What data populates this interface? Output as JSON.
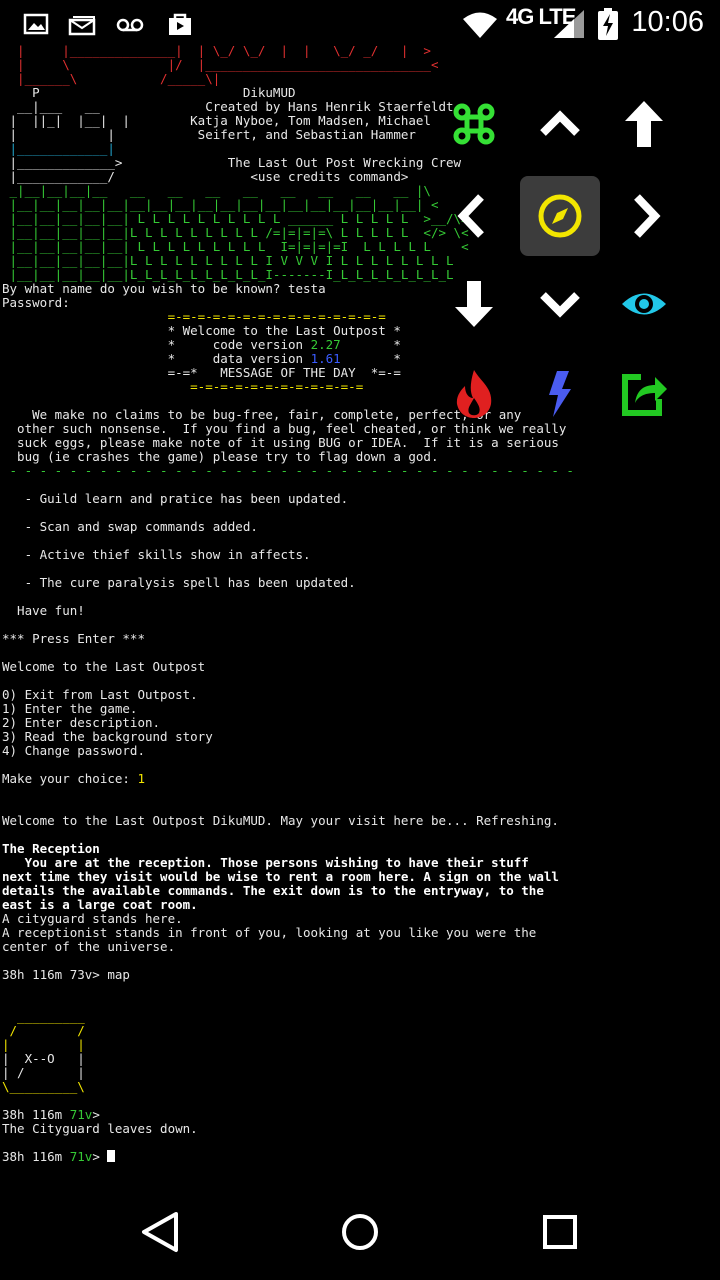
{
  "status_bar": {
    "time": "10:06",
    "network": "4G LTE",
    "icons": [
      "image-icon",
      "mail-stack-icon",
      "voicemail-icon",
      "store-bag-icon",
      "wifi-icon",
      "signal-icon",
      "battery-charging-icon"
    ]
  },
  "terminal": {
    "lines": [
      {
        "t": "  |     |______________|  | \\_/ \\_/  |  |   \\_/ _/   |  >",
        "c": "r"
      },
      {
        "t": "  |     \\             |/  |______________________________<",
        "c": "r"
      },
      {
        "t": "  |______\\           /_____\\|",
        "c": "r"
      },
      {
        "t": "    P                           DikuMUD",
        "c": ""
      },
      {
        "t": "  __|___   __              Created by Hans Henrik Staerfeldt,",
        "c": ""
      },
      {
        "t": " |  ||_|  |__|  |        Katja Nyboe, Tom Madsen, Michael",
        "c": ""
      },
      {
        "t": " |            |           Seifert, and Sebastian Hammer",
        "c": ""
      },
      {
        "t": " |____________|",
        "c": "c"
      },
      {
        "t": " |_____________>              The Last Out Post Wrecking Crew",
        "c": ""
      },
      {
        "t": " |____________/                  <use credits command>",
        "c": ""
      },
      {
        "t": " _|__|__|__|__   __   __   __   __   __   __   __   __ |\\",
        "c": "g"
      },
      {
        "t": " |__|__|__|__|__|__|__|__|__|__|__|__|__|__|__|__|__|__| <",
        "c": "g"
      },
      {
        "t": " |__|__|__|__|__| L L L L L L L L L L ______ L L L L L  >__/\\>",
        "c": "g"
      },
      {
        "t": " |__|__|__|__|__|L L L L L L L L L /=|=|=|=\\ L L L L L  </> \\<",
        "c": "g"
      },
      {
        "t": " |__|__|__|__|__| L L L L L L L L L  I=|=|=|=I  L L L L L    <",
        "c": "g"
      },
      {
        "t": " |__|__|__|__|__|L L L L L L L L L I V V V I L L L L L L L L",
        "c": "g"
      },
      {
        "t": " |__|__|__|__|__|L_L_L_L_L_L_L_L_L_I-------I_L_L_L_L_L_L_L_L",
        "c": "g"
      },
      {
        "t": "By what name do you wish to be known? testa",
        "c": ""
      },
      {
        "t": "Password:",
        "c": ""
      },
      {
        "t": "                      =-=-=-=-=-=-=-=-=-=-=-=-=-=-=",
        "c": "y"
      },
      {
        "t": "                      * Welcome to the Last Outpost *",
        "c": ""
      },
      {
        "t": "                      *     code version 2.27       *",
        "c": ""
      },
      {
        "t": "                      *     data version 1.61       *",
        "c": ""
      },
      {
        "t": "                      =-=*   MESSAGE OF THE DAY  *=-=",
        "c": ""
      },
      {
        "t": "                         =-=-=-=-=-=-=-=-=-=-=-=",
        "c": "y"
      },
      {
        "t": "",
        "c": ""
      },
      {
        "t": "    We make no claims to be bug-free, fair, complete, perfect, or any",
        "c": ""
      },
      {
        "t": "  other such nonsense.  If you find a bug, feel cheated, or think we really",
        "c": ""
      },
      {
        "t": "  suck eggs, please make note of it using BUG or IDEA.  If it is a serious",
        "c": ""
      },
      {
        "t": "  bug (ie crashes the game) please try to flag down a god.",
        "c": ""
      },
      {
        "t": " - - - - - - - - - - - - - - - - - - - - - - - - - - - - - - - - - - - - - -",
        "c": "g"
      },
      {
        "t": "",
        "c": ""
      },
      {
        "t": "   - Guild learn and pratice has been updated.",
        "c": ""
      },
      {
        "t": "",
        "c": ""
      },
      {
        "t": "   - Scan and swap commands added.",
        "c": ""
      },
      {
        "t": "",
        "c": ""
      },
      {
        "t": "   - Active thief skills show in affects.",
        "c": ""
      },
      {
        "t": "",
        "c": ""
      },
      {
        "t": "   - The cure paralysis spell has been updated.",
        "c": ""
      },
      {
        "t": "",
        "c": ""
      },
      {
        "t": "  Have fun!",
        "c": ""
      },
      {
        "t": "",
        "c": ""
      },
      {
        "t": "*** Press Enter ***",
        "c": ""
      },
      {
        "t": "",
        "c": ""
      },
      {
        "t": "Welcome to the Last Outpost",
        "c": ""
      },
      {
        "t": "",
        "c": ""
      },
      {
        "t": "0) Exit from Last Outpost.",
        "c": ""
      },
      {
        "t": "1) Enter the game.",
        "c": ""
      },
      {
        "t": "2) Enter description.",
        "c": ""
      },
      {
        "t": "3) Read the background story",
        "c": ""
      },
      {
        "t": "4) Change password.",
        "c": ""
      },
      {
        "t": "",
        "c": ""
      },
      {
        "t": "Make your choice: 1",
        "c": ""
      },
      {
        "t": "",
        "c": ""
      },
      {
        "t": "",
        "c": ""
      },
      {
        "t": "Welcome to the Last Outpost DikuMUD. May your visit here be... Refreshing.",
        "c": ""
      },
      {
        "t": "",
        "c": ""
      },
      {
        "t": "The Reception",
        "c": "w"
      },
      {
        "t": "   You are at the reception. Those persons wishing to have their stuff",
        "c": "w"
      },
      {
        "t": "next time they visit would be wise to rent a room here. A sign on the wall",
        "c": "w"
      },
      {
        "t": "details the available commands. The exit down is to the entryway, to the",
        "c": "w"
      },
      {
        "t": "east is a large coat room.",
        "c": "w"
      },
      {
        "t": "A cityguard stands here.",
        "c": ""
      },
      {
        "t": "A receptionist stands in front of you, looking at you like you were the",
        "c": ""
      },
      {
        "t": "center of the universe.",
        "c": ""
      },
      {
        "t": "",
        "c": ""
      },
      {
        "t": "38h 116m 73v> map",
        "c": ""
      },
      {
        "t": "",
        "c": ""
      },
      {
        "t": "",
        "c": ""
      },
      {
        "t": "  _________",
        "c": "y"
      },
      {
        "t": " /        /",
        "c": "y"
      },
      {
        "t": "|         |",
        "c": "y"
      },
      {
        "t": "|  X--O   |",
        "c": ""
      },
      {
        "t": "| /       |",
        "c": ""
      },
      {
        "t": "\\_________\\",
        "c": "y"
      },
      {
        "t": "",
        "c": ""
      },
      {
        "t": "38h 116m 71v>",
        "c": ""
      },
      {
        "t": "The Cityguard leaves down.",
        "c": ""
      },
      {
        "t": "",
        "c": ""
      },
      {
        "t": "38h 116m 71v> ",
        "c": ""
      }
    ],
    "values": {
      "code_version": "2.27",
      "data_version": "1.61",
      "choice": "1",
      "prompt1_moves": "73v",
      "prompt2_moves": "71v",
      "map_command": "map"
    }
  },
  "controls": {
    "buttons": [
      {
        "name": "command-key-icon",
        "color": "#35e035"
      },
      {
        "name": "chevron-up-icon",
        "color": "#ffffff"
      },
      {
        "name": "arrow-up-icon",
        "color": "#ffffff"
      },
      {
        "name": "chevron-left-icon",
        "color": "#ffffff"
      },
      {
        "name": "compass-icon",
        "color": "#f2e600"
      },
      {
        "name": "chevron-right-icon",
        "color": "#ffffff"
      },
      {
        "name": "arrow-down-icon",
        "color": "#ffffff"
      },
      {
        "name": "chevron-down-icon",
        "color": "#ffffff"
      },
      {
        "name": "eye-icon",
        "color": "#22c8e8"
      },
      {
        "name": "flame-icon",
        "color": "#e02020"
      },
      {
        "name": "lightning-icon",
        "color": "#4a5cf0"
      },
      {
        "name": "share-icon",
        "color": "#22c822"
      }
    ]
  },
  "nav_bar": {
    "icons": [
      "back-icon",
      "home-icon",
      "recents-icon"
    ]
  }
}
